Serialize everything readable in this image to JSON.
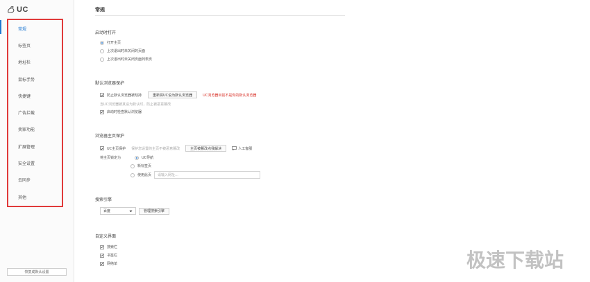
{
  "app": {
    "logo_text": "UC"
  },
  "sidebar": {
    "items": [
      {
        "label": "常规",
        "active": true
      },
      {
        "label": "标签页",
        "active": false
      },
      {
        "label": "地址栏",
        "active": false
      },
      {
        "label": "鼠标手势",
        "active": false
      },
      {
        "label": "快捷键",
        "active": false
      },
      {
        "label": "广告拦截",
        "active": false
      },
      {
        "label": "卖家功能",
        "active": false
      },
      {
        "label": "扩展管理",
        "active": false
      },
      {
        "label": "安全设置",
        "active": false
      },
      {
        "label": "云同步",
        "active": false
      },
      {
        "label": "其他",
        "active": false
      }
    ],
    "restore_label": "恢复成默认设置",
    "highlight_color": "#e03a3a",
    "accent_color": "#1f78d1"
  },
  "main": {
    "title": "常规",
    "startup": {
      "title": "启动时打开",
      "options": [
        "打开主页",
        "上次退出时未关闭的页面",
        "上次退出时未关闭页面列表页"
      ],
      "selected": 0
    },
    "default_browser": {
      "title": "默认浏览器保护",
      "protect_label": "防止默认浏览器被劫持",
      "reset_button": "重新将UC设为默认浏览器",
      "warning": "UC浏览器目前不是你的默认浏览器",
      "hint": "当UC浏览器被其设为默认时，防止被恶意篡改",
      "check_on_start": "启动时检查默认浏览器"
    },
    "homepage_protect": {
      "title": "浏览器主页保护",
      "protect_label": "UC主页保护",
      "protect_hint": "保护您设置的主页不被恶意篡改",
      "tampered_button": "主页被篡改点我解决",
      "support_label": "人工客服",
      "lock_label": "将主页锁定为",
      "lock_options": [
        "UC导航",
        "新标签页",
        "使用此页"
      ],
      "selected": 0,
      "url_placeholder": "请输入网址..."
    },
    "search": {
      "title": "搜索引擎",
      "selected_engine": "百度",
      "manage_button": "管理搜索引擎"
    },
    "custom_ui": {
      "title": "自定义界面",
      "items": [
        "搜索栏",
        "书签栏",
        "网络单"
      ]
    }
  },
  "watermark": "极速下载站"
}
